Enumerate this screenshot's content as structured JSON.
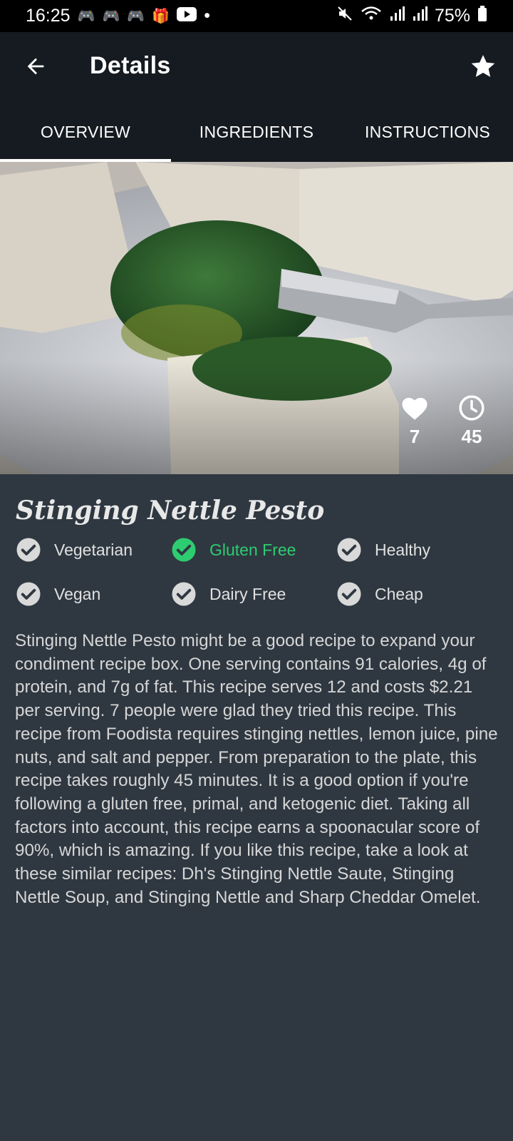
{
  "status_bar": {
    "time": "16:25",
    "notification_icons": [
      "gamepad-icon",
      "gamepad-icon",
      "gamepad-icon",
      "gift-icon",
      "youtube-icon",
      "dot-icon"
    ],
    "battery": "75%",
    "system_icons": [
      "mute-icon",
      "wifi-icon",
      "signal-icon",
      "signal-icon",
      "battery-icon"
    ]
  },
  "app_bar": {
    "title": "Details"
  },
  "tabs": [
    {
      "label": "OVERVIEW",
      "active": true
    },
    {
      "label": "INGREDIENTS",
      "active": false
    },
    {
      "label": "INSTRUCTIONS",
      "active": false
    }
  ],
  "hero": {
    "likes": "7",
    "minutes": "45"
  },
  "recipe": {
    "title": "Stinging Nettle Pesto",
    "tags": [
      {
        "label": "Vegetarian",
        "on": false
      },
      {
        "label": "Gluten Free",
        "on": true
      },
      {
        "label": "Healthy",
        "on": false
      },
      {
        "label": "Vegan",
        "on": false
      },
      {
        "label": "Dairy Free",
        "on": false
      },
      {
        "label": "Cheap",
        "on": false
      }
    ],
    "description": "Stinging Nettle Pesto might be a good recipe to expand your condiment recipe box. One serving contains 91 calories, 4g of protein, and 7g of fat. This recipe serves 12 and costs $2.21 per serving. 7 people were glad they tried this recipe. This recipe from Foodista requires stinging nettles, lemon juice, pine nuts, and salt and pepper. From preparation to the plate, this recipe takes roughly 45 minutes. It is a good option if you're following a gluten free, primal, and ketogenic diet. Taking all factors into account, this recipe earns a spoonacular score of 90%, which is amazing. If you like this recipe, take a look at these similar recipes: Dh's Stinging Nettle Saute, Stinging Nettle Soup, and Stinging Nettle and Sharp Cheddar Omelet."
  },
  "colors": {
    "background": "#2f3841",
    "app_bar": "#161b21",
    "accent_green": "#2ecc71",
    "inactive_check": "#d9d9d9"
  }
}
